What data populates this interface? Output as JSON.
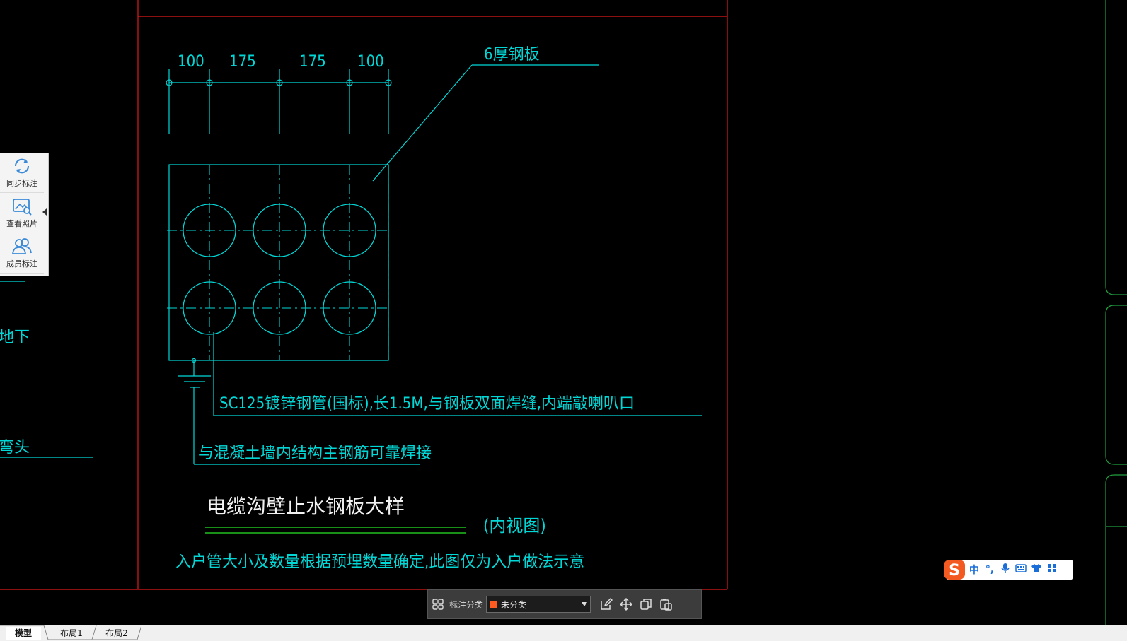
{
  "drawing": {
    "dimensions": [
      "100",
      "175",
      "175",
      "100"
    ],
    "plate_label": "6厚钢板",
    "pipe_note": "SC125镀锌钢管(国标),长1.5M,与钢板双面焊缝,内端敲喇叭口",
    "weld_note": "与混凝土墙内结构主钢筋可靠焊接",
    "title": "电缆沟壁止水钢板大样",
    "view_note": "(内视图)",
    "footnote": "入户管大小及数量根据预埋数量确定,此图仅为入户做法示意",
    "left_partial_1": "地下",
    "left_partial_2": "弯头"
  },
  "side_panel": {
    "items": [
      {
        "label": "同步标注",
        "icon": "sync-icon"
      },
      {
        "label": "查看照片",
        "icon": "photo-icon"
      },
      {
        "label": "成员标注",
        "icon": "members-icon"
      }
    ]
  },
  "annotation_bar": {
    "category_label": "标注分类",
    "category_value": "未分类",
    "category_color": "#ff5a1f"
  },
  "ime": {
    "logo": "S",
    "items": [
      "中",
      "°,",
      "🎤",
      "⌨",
      "👕",
      "▦"
    ]
  },
  "tabs": [
    "模型",
    "布局1",
    "布局2"
  ],
  "colors": {
    "frame": "#e01a1a",
    "line": "#00d8d8",
    "underline": "#20c020"
  }
}
